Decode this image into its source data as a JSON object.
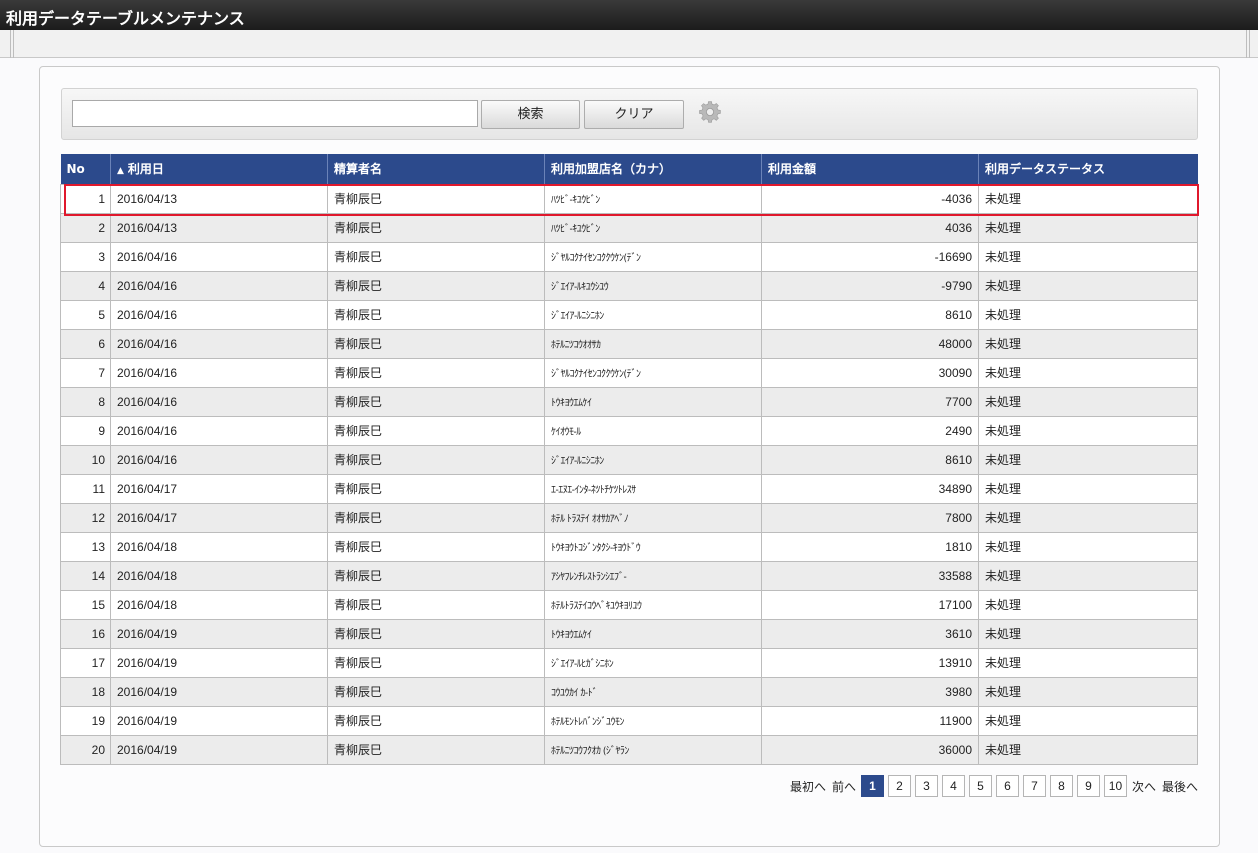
{
  "app": {
    "title": "利用データテーブルメンテナンス"
  },
  "search": {
    "value": "",
    "placeholder": "",
    "search_label": "検索",
    "clear_label": "クリア",
    "settings_icon": "gear-icon"
  },
  "table": {
    "columns": {
      "no": "No",
      "date": "利用日",
      "payer": "精算者名",
      "shop": "利用加盟店名（カナ）",
      "amount": "利用金額",
      "status": "利用データステータス"
    },
    "sort": {
      "column": "date",
      "direction": "asc",
      "indicator": "▲"
    },
    "rows": [
      {
        "no": "1",
        "date": "2016/04/13",
        "payer": "青柳辰巳",
        "shop": "ﾊﾂﾋﾞ-ｷﾕｳﾋﾞﾝ",
        "amount": "-4036",
        "status": "未処理"
      },
      {
        "no": "2",
        "date": "2016/04/13",
        "payer": "青柳辰巳",
        "shop": "ﾊﾂﾋﾞ-ｷﾕｳﾋﾞﾝ",
        "amount": "4036",
        "status": "未処理"
      },
      {
        "no": "3",
        "date": "2016/04/16",
        "payer": "青柳辰巳",
        "shop": "ｼﾞﾔﾙｺｸﾅｲｾﾝｺｸｸｳｹﾝ(ﾃﾞﾝ",
        "amount": "-16690",
        "status": "未処理"
      },
      {
        "no": "4",
        "date": "2016/04/16",
        "payer": "青柳辰巳",
        "shop": "ｼﾞｴｲｱ-ﾙｷﾕｳｼﾕｳ",
        "amount": "-9790",
        "status": "未処理"
      },
      {
        "no": "5",
        "date": "2016/04/16",
        "payer": "青柳辰巳",
        "shop": "ｼﾞｴｲｱ-ﾙﾆｼﾆﾎﾝ",
        "amount": "8610",
        "status": "未処理"
      },
      {
        "no": "6",
        "date": "2016/04/16",
        "payer": "青柳辰巳",
        "shop": "ﾎﾃﾙﾆﾂｺｳｵｵｻｶ",
        "amount": "48000",
        "status": "未処理"
      },
      {
        "no": "7",
        "date": "2016/04/16",
        "payer": "青柳辰巳",
        "shop": "ｼﾞﾔﾙｺｸﾅｲｾﾝｺｸｸｳｹﾝ(ﾃﾞﾝ",
        "amount": "30090",
        "status": "未処理"
      },
      {
        "no": "8",
        "date": "2016/04/16",
        "payer": "青柳辰巳",
        "shop": "ﾄｳｷﾖｳｴﾑｹｲ",
        "amount": "7700",
        "status": "未処理"
      },
      {
        "no": "9",
        "date": "2016/04/16",
        "payer": "青柳辰巳",
        "shop": "ｹｲｵｳﾓ-ﾙ",
        "amount": "2490",
        "status": "未処理"
      },
      {
        "no": "10",
        "date": "2016/04/16",
        "payer": "青柳辰巳",
        "shop": "ｼﾞｴｲｱ-ﾙﾆｼﾆﾎﾝ",
        "amount": "8610",
        "status": "未処理"
      },
      {
        "no": "11",
        "date": "2016/04/17",
        "payer": "青柳辰巳",
        "shop": "ｴ-ｴﾇｴ-ｲﾝﾀ-ﾈﾂﾄﾁｹﾂﾄﾚｽｻ",
        "amount": "34890",
        "status": "未処理"
      },
      {
        "no": "12",
        "date": "2016/04/17",
        "payer": "青柳辰巳",
        "shop": "ﾎﾃﾙ ﾄﾗｽﾃｲ ｵｵｻｶｱﾍﾞﾉ",
        "amount": "7800",
        "status": "未処理"
      },
      {
        "no": "13",
        "date": "2016/04/18",
        "payer": "青柳辰巳",
        "shop": "ﾄｳｷﾖｳﾄｺｼﾞﾝﾀｸｼ-ｷﾖｳﾄﾞｳ",
        "amount": "1810",
        "status": "未処理"
      },
      {
        "no": "14",
        "date": "2016/04/18",
        "payer": "青柳辰巳",
        "shop": "ｱｼﾔﾌﾚﾝﾁﾚｽﾄﾗﾝｼｴﾌﾞ-",
        "amount": "33588",
        "status": "未処理"
      },
      {
        "no": "15",
        "date": "2016/04/18",
        "payer": "青柳辰巳",
        "shop": "ﾎﾃﾙﾄﾗｽﾃｲｺｳﾍﾞｷﾕｳｷﾖﾘﾕｳ",
        "amount": "17100",
        "status": "未処理"
      },
      {
        "no": "16",
        "date": "2016/04/19",
        "payer": "青柳辰巳",
        "shop": "ﾄｳｷﾖｳｴﾑｹｲ",
        "amount": "3610",
        "status": "未処理"
      },
      {
        "no": "17",
        "date": "2016/04/19",
        "payer": "青柳辰巳",
        "shop": "ｼﾞｴｲｱ-ﾙﾋｶﾞｼﾆﾎﾝ",
        "amount": "13910",
        "status": "未処理"
      },
      {
        "no": "18",
        "date": "2016/04/19",
        "payer": "青柳辰巳",
        "shop": "ｺｳﾕｳｶｲ ｶ-ﾄﾞ",
        "amount": "3980",
        "status": "未処理"
      },
      {
        "no": "19",
        "date": "2016/04/19",
        "payer": "青柳辰巳",
        "shop": "ﾎﾃﾙﾓﾝﾄﾚﾊﾞﾝｼﾞﾕｳﾓﾝ",
        "amount": "11900",
        "status": "未処理"
      },
      {
        "no": "20",
        "date": "2016/04/19",
        "payer": "青柳辰巳",
        "shop": "ﾎﾃﾙﾆﾂｺｳﾌｸｵｶ (ｼﾞﾔﾗﾝ",
        "amount": "36000",
        "status": "未処理"
      }
    ],
    "selected_row": "1"
  },
  "pager": {
    "first_label": "最初へ",
    "prev_label": "前へ",
    "next_label": "次へ",
    "last_label": "最後へ",
    "pages": [
      "1",
      "2",
      "3",
      "4",
      "5",
      "6",
      "7",
      "8",
      "9",
      "10"
    ],
    "current": "1"
  },
  "colors": {
    "header": "#2c4a8c",
    "highlight": "#e0182c",
    "titlebar": "#1c1c1c"
  }
}
